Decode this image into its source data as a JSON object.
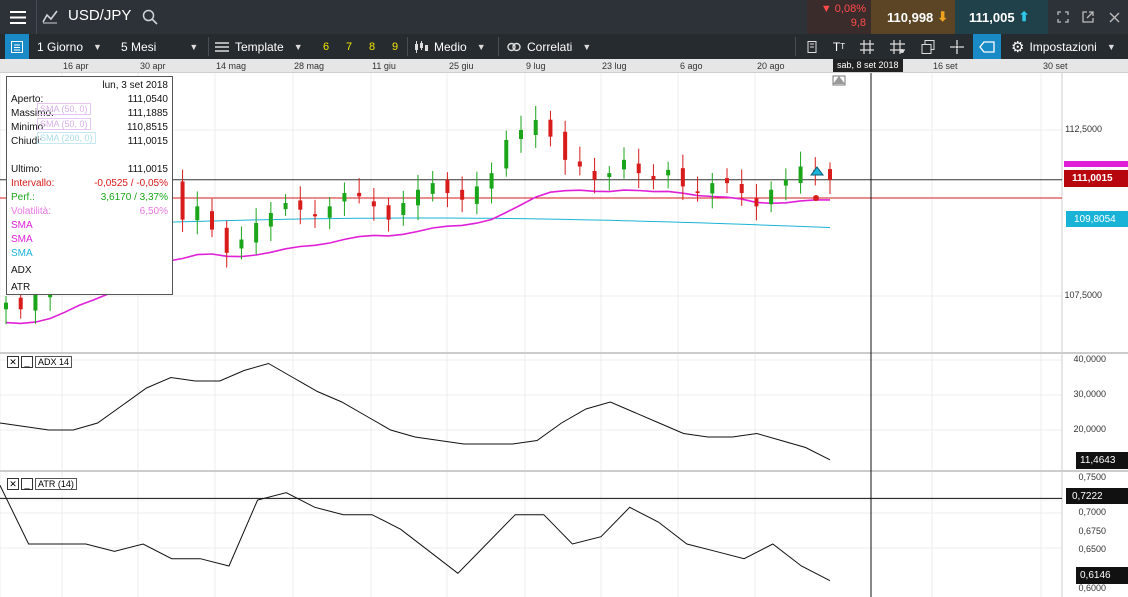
{
  "topbar": {
    "symbol": "USD/JPY",
    "change_pct": "0,08%",
    "change_pts": "9,8",
    "bid": "110,998",
    "ask": "111,005",
    "icons": [
      "menu-icon",
      "trend-icon",
      "search-icon",
      "fullscreen-icon",
      "popout-icon",
      "close-icon"
    ]
  },
  "toolbar": {
    "period": "1 Giorno",
    "range": "5 Mesi",
    "template": "Template",
    "presets": [
      "6",
      "7",
      "8",
      "9"
    ],
    "chart_type": "Medio",
    "correlated": "Correlati",
    "settings": "Impostazioni"
  },
  "date_axis": {
    "labels": [
      "16 apr",
      "30 apr",
      "14 mag",
      "28 mag",
      "11 giu",
      "25 giu",
      "9 lug",
      "23 lug",
      "6 ago",
      "20 ago",
      "16 set",
      "30 set"
    ],
    "current": "sab, 8 set 2018"
  },
  "infobox": {
    "date": "lun, 3 set 2018",
    "rows": [
      {
        "label": "Aperto:",
        "value": "111,0540"
      },
      {
        "label": "Massimo:",
        "value": "111,1885"
      },
      {
        "label": "Minimo:",
        "value": "110,8515"
      },
      {
        "label": "Chiudi:",
        "value": "111,0015"
      },
      {
        "label": "Ultimo:",
        "value": "111,0015"
      },
      {
        "label": "Intervallo:",
        "value": "-0,0525 / -0,05%"
      },
      {
        "label": "Perf.:",
        "value": "3,6170 / 3,37%"
      },
      {
        "label": "Volatilità:",
        "value": "6,50%"
      }
    ],
    "indicators": [
      "SMA",
      "SMA",
      "SMA",
      "ADX",
      "ATR"
    ],
    "faded_labels": [
      "SMA (50, 0)",
      "SMA (50, 0)",
      "SMA (200, 0)"
    ]
  },
  "colors": {
    "sma_magenta": "#e020d8",
    "sma_cyan": "#1ab3d8",
    "up": "#1aa51a",
    "down": "#d81b1b",
    "last_price": "#b8060f"
  },
  "panes": {
    "price": {
      "axis_labels": [
        "112,5000",
        "107,5000"
      ],
      "last_price": "111,0015",
      "sma_tag_magenta": "",
      "sma_tag_cyan": "109,8054"
    },
    "adx": {
      "name": "ADX 14",
      "axis_labels": [
        "40,0000",
        "30,0000",
        "20,0000"
      ],
      "last": "11,4643"
    },
    "atr": {
      "name": "ATR (14)",
      "axis_labels": [
        "0,7500",
        "0,7000",
        "0,6750",
        "0,6500",
        "0,6000"
      ],
      "level": "0,7222",
      "last": "0,6146"
    }
  },
  "chart_data": {
    "type": "candlestick",
    "x_range": [
      "16 apr 2018",
      "30 set 2018"
    ],
    "close_series_approx": [
      107.3,
      107.1,
      107.6,
      108.2,
      109.0,
      109.4,
      109.2,
      109.5,
      109.9,
      110.6,
      111.0,
      110.8,
      109.8,
      110.2,
      109.5,
      108.8,
      109.2,
      109.7,
      110.0,
      110.3,
      110.1,
      109.9,
      110.2,
      110.6,
      110.5,
      110.2,
      109.8,
      110.3,
      110.7,
      110.9,
      110.6,
      110.4,
      110.8,
      111.2,
      112.2,
      112.5,
      112.8,
      112.3,
      111.6,
      111.4,
      111.0,
      111.2,
      111.6,
      111.2,
      111.0,
      111.3,
      110.8,
      110.6,
      110.9,
      110.9,
      110.6,
      110.2,
      110.7,
      111.0,
      111.4,
      111.2,
      111.0
    ],
    "adx_approx": [
      22,
      21,
      20,
      20,
      22,
      27,
      32,
      35,
      34,
      34,
      37,
      39,
      35,
      31,
      28,
      24,
      20,
      18,
      17,
      16,
      16,
      16,
      17,
      22,
      26,
      28,
      25,
      22,
      19,
      18,
      18,
      19,
      17,
      15,
      11.5
    ],
    "atr_approx": [
      0.74,
      0.66,
      0.66,
      0.66,
      0.65,
      0.66,
      0.64,
      0.64,
      0.63,
      0.72,
      0.73,
      0.71,
      0.7,
      0.7,
      0.68,
      0.65,
      0.62,
      0.66,
      0.7,
      0.7,
      0.66,
      0.67,
      0.71,
      0.69,
      0.66,
      0.65,
      0.64,
      0.66,
      0.63,
      0.61
    ]
  }
}
